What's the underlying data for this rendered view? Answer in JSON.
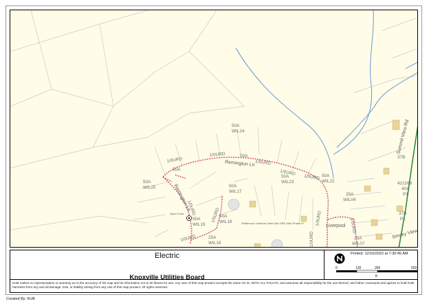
{
  "map": {
    "title": "Electric",
    "organization": "Knoxville Utilities Board",
    "printed": "Printed: 12/16/2022 at 7:30:45 AM",
    "north_arrow_icon": "north-arrow-icon",
    "scale": {
      "ticks": [
        "0",
        "130",
        "260",
        "520"
      ],
      "unit": "ft"
    },
    "disclaimer": "KUB makes no representation or warranty as to the accuracy of his map and its information nor to its fitness for use. Any user of this map product accepts the same AS IS ,WITH ALL FAULTS, and assumes all responsibility for the use thereof, and futher covenants and agrees to hold KUB harmless from any and all damage, loss, or liability arising from any use of this map product. All rights reserved.",
    "created_by": "Created By: KUB",
    "colors": {
      "background": "#fffde8",
      "parcel_lines": "#bdbdbd",
      "streams": "#5b8ad6",
      "circuit": "#d45b7a",
      "road": "#2e8b3a",
      "buildings": "#e8d398"
    }
  },
  "map_labels": {
    "wil25": {
      "rating": "50A",
      "id": "WIL25"
    },
    "wil24": {
      "rating": "50A",
      "id": "WIL24"
    },
    "wil17": {
      "rating": "50A",
      "id": "WIL17"
    },
    "wil23": {
      "rating": "50A",
      "id": "WIL23"
    },
    "wil22": {
      "rating": "50A",
      "id": "WIL22"
    },
    "wil18": {
      "rating": "50A",
      "id": "WIL18"
    },
    "wil19": {
      "rating": "50A",
      "id": "WIL19"
    },
    "wil16": {
      "rating": "25A",
      "id": "WIL16"
    },
    "wil04": {
      "rating": "25A",
      "id": "WIL04"
    },
    "wil07": {
      "rating": "25A",
      "id": "WIL07"
    },
    "p1a": {
      "rating": "421266",
      "code": "40A",
      "id": "P1"
    },
    "p1b": {
      "rating": "37B",
      "id": "P1"
    },
    "p37b": "37B",
    "conductor": "1/0URD",
    "streets": {
      "remington": "Remington Ln",
      "liverpool": "Liverpool",
      "summit": "Summit View Rd",
      "smoky": "Smoky View"
    },
    "small": {
      "open": "Open Point",
      "whitemoor": "Whitemoor Gardens Subd Sad URD Misc Phase IV"
    }
  }
}
